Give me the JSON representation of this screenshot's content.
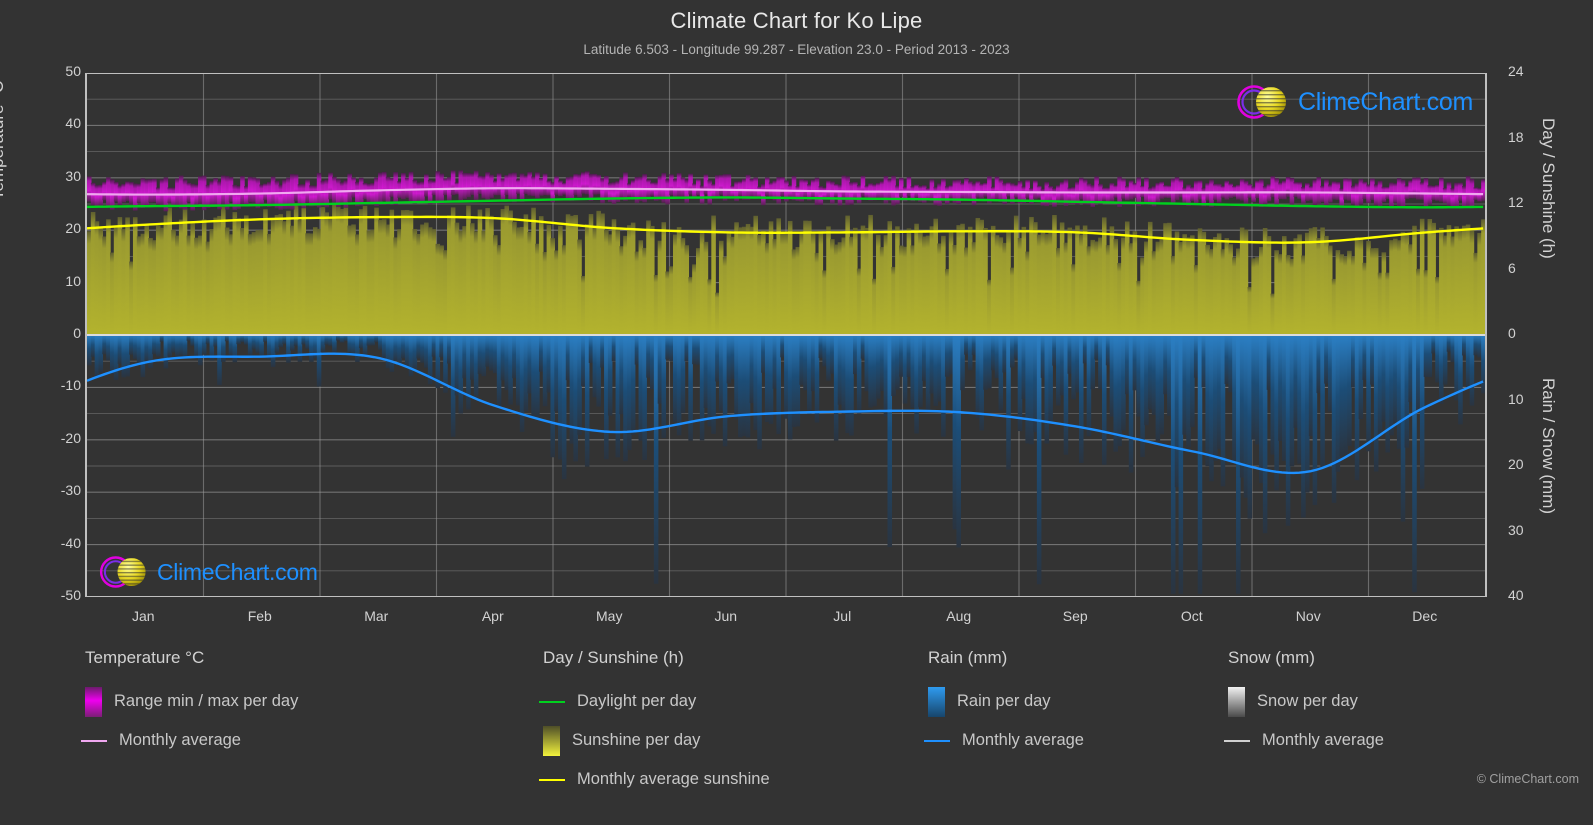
{
  "header": {
    "title": "Climate Chart for Ko Lipe",
    "subtitle": "Latitude 6.503 - Longitude 99.287 - Elevation 23.0 - Period 2013 - 2023"
  },
  "axes": {
    "left_title": "Temperature °C",
    "right_title_top": "Day / Sunshine (h)",
    "right_title_bottom": "Rain / Snow (mm)",
    "left_ticks": [
      "50",
      "40",
      "30",
      "20",
      "10",
      "0",
      "-10",
      "-20",
      "-30",
      "-40",
      "-50"
    ],
    "right_ticks_top": [
      "24",
      "18",
      "12",
      "6",
      "0"
    ],
    "right_ticks_bottom": [
      "10",
      "20",
      "30",
      "40"
    ],
    "x_ticks": [
      "Jan",
      "Feb",
      "Mar",
      "Apr",
      "May",
      "Jun",
      "Jul",
      "Aug",
      "Sep",
      "Oct",
      "Nov",
      "Dec"
    ]
  },
  "legend": {
    "temperature": {
      "heading": "Temperature °C",
      "items": [
        {
          "label": "Range min / max per day",
          "marker": "swatch",
          "color": "#e500e5"
        },
        {
          "label": "Monthly average",
          "marker": "line",
          "color": "#f0a8f0"
        }
      ]
    },
    "daysun": {
      "heading": "Day / Sunshine (h)",
      "items": [
        {
          "label": "Daylight per day",
          "marker": "line",
          "color": "#00d11e"
        },
        {
          "label": "Sunshine per day",
          "marker": "swatch",
          "color": "#e8e82a"
        },
        {
          "label": "Monthly average sunshine",
          "marker": "line",
          "color": "#ffff00"
        }
      ]
    },
    "rain": {
      "heading": "Rain (mm)",
      "items": [
        {
          "label": "Rain per day",
          "marker": "swatch",
          "color": "#1e90ff"
        },
        {
          "label": "Monthly average",
          "marker": "line",
          "color": "#1e90ff"
        }
      ]
    },
    "snow": {
      "heading": "Snow (mm)",
      "items": [
        {
          "label": "Snow per day",
          "marker": "swatch",
          "color": "#e0e0e0"
        },
        {
          "label": "Monthly average",
          "marker": "line",
          "color": "#d0d0d0"
        }
      ]
    }
  },
  "branding": {
    "logo_text": "ClimeChart.com",
    "copyright": "© ClimeChart.com"
  },
  "chart_data": {
    "type": "area",
    "title": "Climate Chart for Ko Lipe",
    "subtitle": "Latitude 6.503 - Longitude 99.287 - Elevation 23.0 - Period 2013 - 2023",
    "xlabel": "",
    "ylabel": "Temperature °C",
    "ylabel_right_top": "Day / Sunshine (h)",
    "ylabel_right_bottom": "Rain / Snow (mm)",
    "ylim": [
      -50,
      50
    ],
    "ylim_right_top": [
      0,
      24
    ],
    "ylim_right_bottom": [
      0,
      40
    ],
    "grid": true,
    "legend_position": "below",
    "categories": [
      "Jan",
      "Feb",
      "Mar",
      "Apr",
      "May",
      "Jun",
      "Jul",
      "Aug",
      "Sep",
      "Oct",
      "Nov",
      "Dec"
    ],
    "series": [
      {
        "name": "Monthly average temperature",
        "unit": "°C",
        "axis": "left",
        "color": "#f0a8f0",
        "values": [
          26.8,
          27.0,
          27.6,
          28.0,
          27.9,
          27.7,
          27.4,
          27.3,
          27.2,
          27.2,
          27.2,
          27.0
        ]
      },
      {
        "name": "Range min / max per day",
        "unit": "°C",
        "axis": "left",
        "color": "#e500e5",
        "min_values": [
          24.6,
          24.8,
          25.4,
          26.0,
          26.0,
          25.8,
          25.6,
          25.5,
          25.4,
          25.4,
          25.4,
          25.1
        ],
        "max_values": [
          29.2,
          29.5,
          30.0,
          30.3,
          30.0,
          29.6,
          29.3,
          29.2,
          29.1,
          29.2,
          29.2,
          29.1
        ]
      },
      {
        "name": "Daylight per day",
        "unit": "h",
        "axis": "right_top",
        "color": "#00d11e",
        "values": [
          11.8,
          11.9,
          12.1,
          12.3,
          12.5,
          12.6,
          12.5,
          12.4,
          12.2,
          12.0,
          11.8,
          11.7
        ]
      },
      {
        "name": "Monthly average sunshine",
        "unit": "h",
        "axis": "right_top",
        "color": "#ffff00",
        "values": [
          10.1,
          10.6,
          10.8,
          10.7,
          9.8,
          9.4,
          9.4,
          9.5,
          9.4,
          8.7,
          8.5,
          9.4
        ]
      },
      {
        "name": "Monthly average rain",
        "unit": "mm",
        "axis": "right_bottom",
        "color": "#1e90ff",
        "values": [
          4.2,
          3.3,
          3.5,
          10.8,
          14.8,
          12.4,
          11.7,
          11.8,
          14.0,
          17.8,
          20.8,
          10.9
        ]
      },
      {
        "name": "Monthly average snow",
        "unit": "mm",
        "axis": "right_bottom",
        "color": "#d0d0d0",
        "values": [
          0,
          0,
          0,
          0,
          0,
          0,
          0,
          0,
          0,
          0,
          0,
          0
        ]
      }
    ]
  }
}
